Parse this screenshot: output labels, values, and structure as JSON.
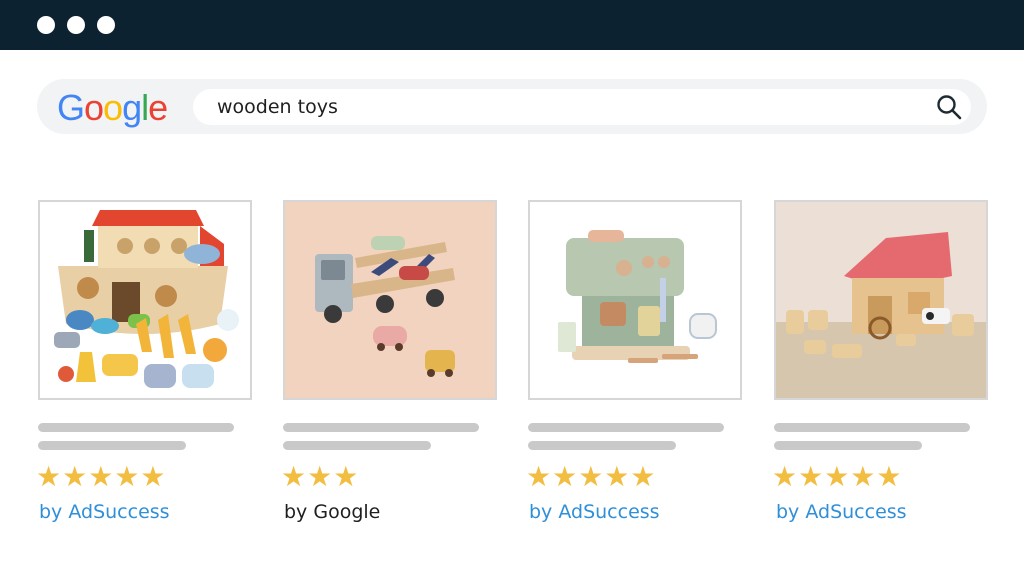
{
  "window": {
    "dots": [
      "close",
      "minimize",
      "maximize"
    ]
  },
  "search": {
    "logo_letters": [
      {
        "char": "G",
        "color": "#4285f4"
      },
      {
        "char": "o",
        "color": "#ea4335"
      },
      {
        "char": "o",
        "color": "#fbbc05"
      },
      {
        "char": "g",
        "color": "#4285f4"
      },
      {
        "char": "l",
        "color": "#34a853"
      },
      {
        "char": "e",
        "color": "#ea4335"
      }
    ],
    "query": "wooden toys",
    "icon": "search-icon"
  },
  "results": [
    {
      "image": "wooden noah's ark toy with animals",
      "rating": 5,
      "stars": "★★★★★",
      "byline": "by AdSuccess",
      "sponsored": true
    },
    {
      "image": "wooden car transporter truck toy",
      "rating": 3,
      "stars": "★★★",
      "byline": "by Google",
      "sponsored": false
    },
    {
      "image": "wooden toy coffee machine",
      "rating": 5,
      "stars": "★★★★★",
      "byline": "by AdSuccess",
      "sponsored": true
    },
    {
      "image": "wooden farm house with animals",
      "rating": 5,
      "stars": "★★★★★",
      "byline": "by AdSuccess",
      "sponsored": true
    }
  ],
  "colors": {
    "titlebar": "#0c2230",
    "star": "#f2be42",
    "ad_link": "#2f8fd8",
    "placeholder_bar": "#c9c9c9"
  }
}
